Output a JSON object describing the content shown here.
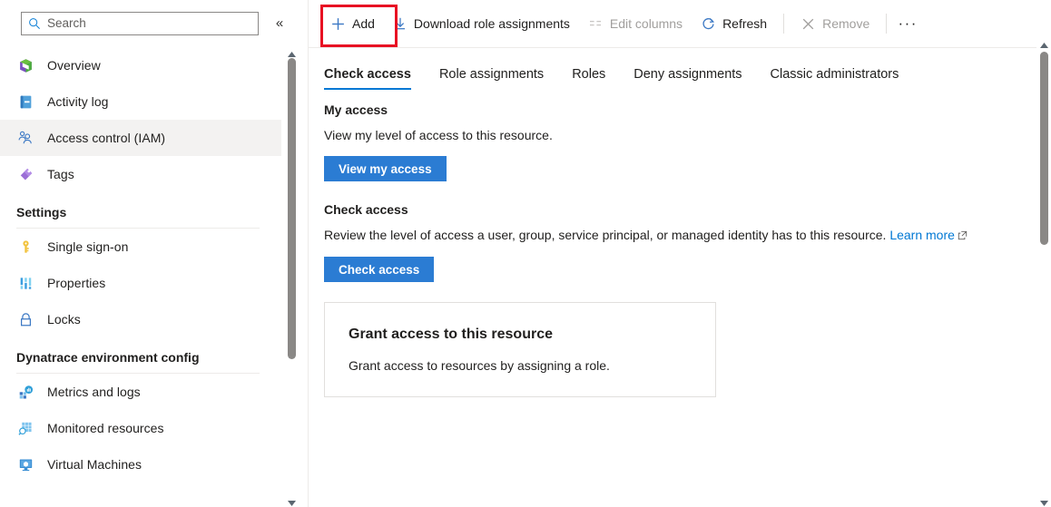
{
  "sidebar": {
    "search": {
      "placeholder": "Search",
      "value": "",
      "icon": "search-icon"
    },
    "collapse": {
      "icon": "chevron-double-left-icon",
      "glyph": "«"
    },
    "items": [
      {
        "label": "Overview",
        "icon": "overview-cube-icon",
        "selected": false
      },
      {
        "label": "Activity log",
        "icon": "activity-log-book-icon",
        "selected": false
      },
      {
        "label": "Access control (IAM)",
        "icon": "access-control-people-icon",
        "selected": true
      },
      {
        "label": "Tags",
        "icon": "tags-icon",
        "selected": false
      }
    ],
    "groups": [
      {
        "title": "Settings",
        "items": [
          {
            "label": "Single sign-on",
            "icon": "key-icon",
            "selected": false
          },
          {
            "label": "Properties",
            "icon": "properties-bars-icon",
            "selected": false
          },
          {
            "label": "Locks",
            "icon": "lock-icon",
            "selected": false
          }
        ]
      },
      {
        "title": "Dynatrace environment config",
        "items": [
          {
            "label": "Metrics and logs",
            "icon": "metrics-and-logs-icon",
            "selected": false
          },
          {
            "label": "Monitored resources",
            "icon": "monitored-resources-icon",
            "selected": false
          },
          {
            "label": "Virtual Machines",
            "icon": "virtual-machines-icon",
            "selected": false
          }
        ]
      }
    ],
    "scrollbar": {
      "up_glyph": "▲",
      "down_glyph": "▼"
    }
  },
  "toolbar": {
    "add": {
      "label": "Add",
      "icon": "plus-icon",
      "disabled": false,
      "highlighted": true
    },
    "download": {
      "label": "Download role assignments",
      "icon": "download-arrow-icon",
      "disabled": false
    },
    "edit_columns": {
      "label": "Edit columns",
      "icon": "edit-columns-icon",
      "disabled": true
    },
    "refresh": {
      "label": "Refresh",
      "icon": "refresh-circular-arrow-icon",
      "disabled": false
    },
    "remove": {
      "label": "Remove",
      "icon": "close-x-icon",
      "disabled": true
    },
    "more": {
      "label": "···",
      "icon": "ellipsis-icon"
    },
    "highlight_color": "#e81123"
  },
  "tabs": [
    {
      "label": "Check access",
      "active": true
    },
    {
      "label": "Role assignments",
      "active": false
    },
    {
      "label": "Roles",
      "active": false
    },
    {
      "label": "Deny assignments",
      "active": false
    },
    {
      "label": "Classic administrators",
      "active": false
    }
  ],
  "main": {
    "my_access": {
      "title": "My access",
      "description": "View my level of access to this resource.",
      "button_label": "View my access"
    },
    "check_access": {
      "title": "Check access",
      "description": "Review the level of access a user, group, service principal, or managed identity has to this resource. ",
      "link_label": "Learn more",
      "link_icon": "external-link-icon",
      "button_label": "Check access"
    },
    "grant_card": {
      "title": "Grant access to this resource",
      "description": "Grant access to resources by assigning a role."
    }
  },
  "colors": {
    "accent": "#0078d4",
    "button": "#2b7cd3",
    "highlight": "#e81123",
    "selected_bg": "#f3f2f1",
    "disabled_text": "#a19f9d",
    "border": "#e1dfdd"
  }
}
